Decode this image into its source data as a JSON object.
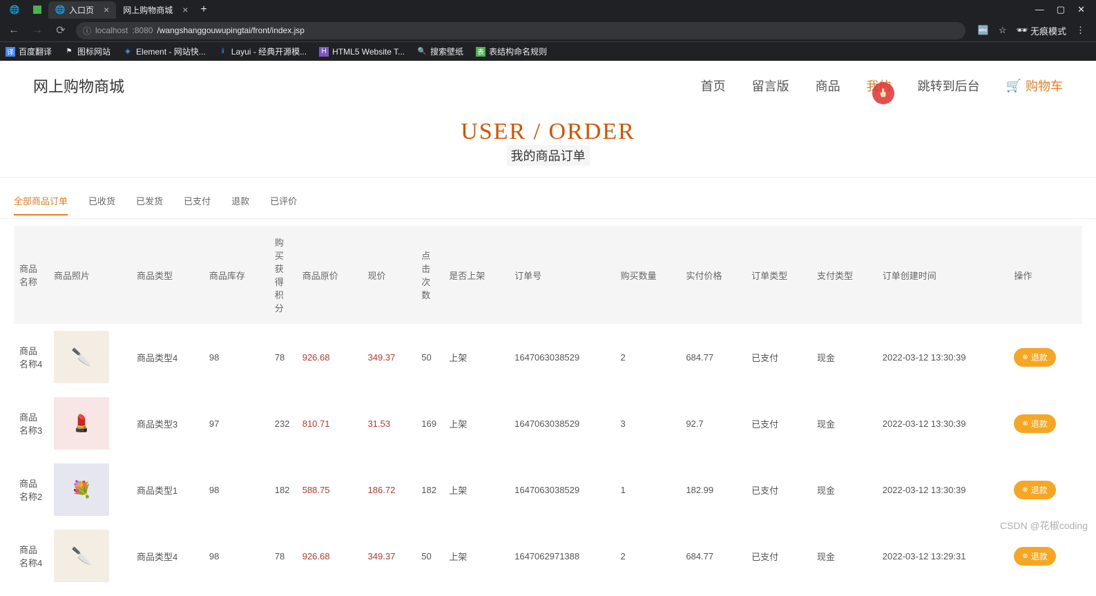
{
  "browser": {
    "tabs": [
      {
        "title": "入口页",
        "active": true
      },
      {
        "title": "网上购物商城",
        "active": false
      }
    ],
    "url_host": "localhost",
    "url_port": ":8080",
    "url_path": "/wangshanggouwupingtai/front/index.jsp",
    "incognito_label": "无痕模式",
    "bookmarks": [
      "百度翻译",
      "图标网站",
      "Element - 网站快...",
      "Layui - 经典开源模...",
      "HTML5 Website T...",
      "搜索壁纸",
      "表结构命名规则"
    ]
  },
  "site": {
    "logo": "网上购物商城",
    "nav": {
      "home": "首页",
      "msgboard": "留言版",
      "products": "商品",
      "mine": "我的",
      "admin": "跳转到后台",
      "cart": "购物车"
    }
  },
  "page_title": {
    "en": "USER / ORDER",
    "cn": "我的商品订单"
  },
  "order_tabs": {
    "all": "全部商品订单",
    "received": "已收货",
    "shipped": "已发货",
    "paid": "已支付",
    "refund": "退款",
    "reviewed": "已评价"
  },
  "table": {
    "headers": {
      "name": "商品名称",
      "photo": "商品照片",
      "type": "商品类型",
      "stock": "商品库存",
      "points": "购买获得积分",
      "orig_price": "商品原价",
      "now_price": "现价",
      "clicks": "点击次数",
      "onshelf": "是否上架",
      "orderno": "订单号",
      "qty": "购买数量",
      "paid": "实付价格",
      "ordertype": "订单类型",
      "paytype": "支付类型",
      "created": "订单创建时间",
      "action": "操作"
    },
    "action_label": "退款",
    "rows": [
      {
        "name": "商品名称4",
        "img": "knives",
        "type": "商品类型4",
        "stock": "98",
        "points": "78",
        "orig": "926.68",
        "now": "349.37",
        "clicks": "50",
        "onshelf": "上架",
        "orderno": "1647063038529",
        "qty": "2",
        "paid": "684.77",
        "ordertype": "已支付",
        "paytype": "现金",
        "created": "2022-03-12 13:30:39"
      },
      {
        "name": "商品名称3",
        "img": "cosmetics",
        "type": "商品类型3",
        "stock": "97",
        "points": "232",
        "orig": "810.71",
        "now": "31.53",
        "clicks": "169",
        "onshelf": "上架",
        "orderno": "1647063038529",
        "qty": "3",
        "paid": "92.7",
        "ordertype": "已支付",
        "paytype": "现金",
        "created": "2022-03-12 13:30:39"
      },
      {
        "name": "商品名称2",
        "img": "flowers",
        "type": "商品类型1",
        "stock": "98",
        "points": "182",
        "orig": "588.75",
        "now": "186.72",
        "clicks": "182",
        "onshelf": "上架",
        "orderno": "1647063038529",
        "qty": "1",
        "paid": "182.99",
        "ordertype": "已支付",
        "paytype": "现金",
        "created": "2022-03-12 13:30:39"
      },
      {
        "name": "商品名称4",
        "img": "knives",
        "type": "商品类型4",
        "stock": "98",
        "points": "78",
        "orig": "926.68",
        "now": "349.37",
        "clicks": "50",
        "onshelf": "上架",
        "orderno": "1647062971388",
        "qty": "2",
        "paid": "684.77",
        "ordertype": "已支付",
        "paytype": "现金",
        "created": "2022-03-12 13:29:31"
      }
    ]
  },
  "watermark": "CSDN @花椒coding"
}
